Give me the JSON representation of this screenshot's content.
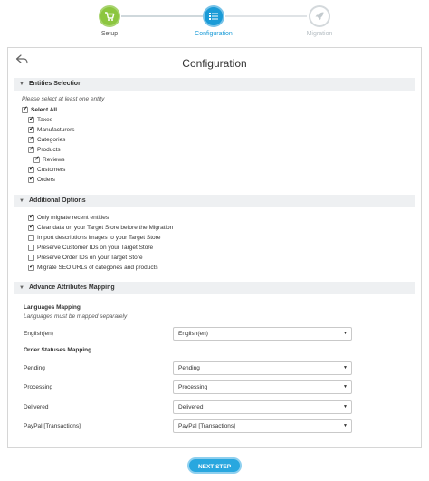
{
  "stepper": {
    "steps": [
      {
        "label": "Setup",
        "icon": "cart-icon",
        "state": "done"
      },
      {
        "label": "Configuration",
        "icon": "list-icon",
        "state": "active"
      },
      {
        "label": "Migration",
        "icon": "rocket-icon",
        "state": "pending"
      }
    ]
  },
  "colors": {
    "accent": "#1a9bd7",
    "done": "#8cc63f",
    "pending": "#d4d9dc",
    "button": "#29a7df"
  },
  "page": {
    "title": "Configuration"
  },
  "entities": {
    "header": "Entities Selection",
    "hint": "Please select at least one entity",
    "select_all": {
      "label": "Select All",
      "checked": true
    },
    "items": [
      {
        "label": "Taxes",
        "checked": true
      },
      {
        "label": "Manufacturers",
        "checked": true
      },
      {
        "label": "Categories",
        "checked": true
      },
      {
        "label": "Products",
        "checked": true
      },
      {
        "label": "Reviews",
        "checked": true
      },
      {
        "label": "Customers",
        "checked": true
      },
      {
        "label": "Orders",
        "checked": true
      }
    ]
  },
  "options": {
    "header": "Additional Options",
    "items": [
      {
        "label": "Only migrate recent entities",
        "checked": true
      },
      {
        "label": "Clear data on your Target Store before the Migration",
        "checked": true
      },
      {
        "label": "Import descriptions images to your Target Store",
        "checked": false
      },
      {
        "label": "Preserve Customer IDs on your Target Store",
        "checked": false
      },
      {
        "label": "Preserve Order IDs on your Target Store",
        "checked": false
      },
      {
        "label": "Migrate SEO URLs of categories and products",
        "checked": true
      }
    ]
  },
  "mapping": {
    "header": "Advance Attributes Mapping",
    "languages_title": "Languages Mapping",
    "languages_hint": "Languages must be mapped separately",
    "language_rows": [
      {
        "label": "English(en)",
        "value": "English(en)"
      }
    ],
    "statuses_title": "Order Statuses Mapping",
    "status_rows": [
      {
        "label": "Pending",
        "value": "Pending"
      },
      {
        "label": "Processing",
        "value": "Processing"
      },
      {
        "label": "Delivered",
        "value": "Delivered"
      },
      {
        "label": "PayPal [Transactions]",
        "value": "PayPal [Transactions]"
      }
    ]
  },
  "footer": {
    "next_label": "NEXT STEP"
  }
}
